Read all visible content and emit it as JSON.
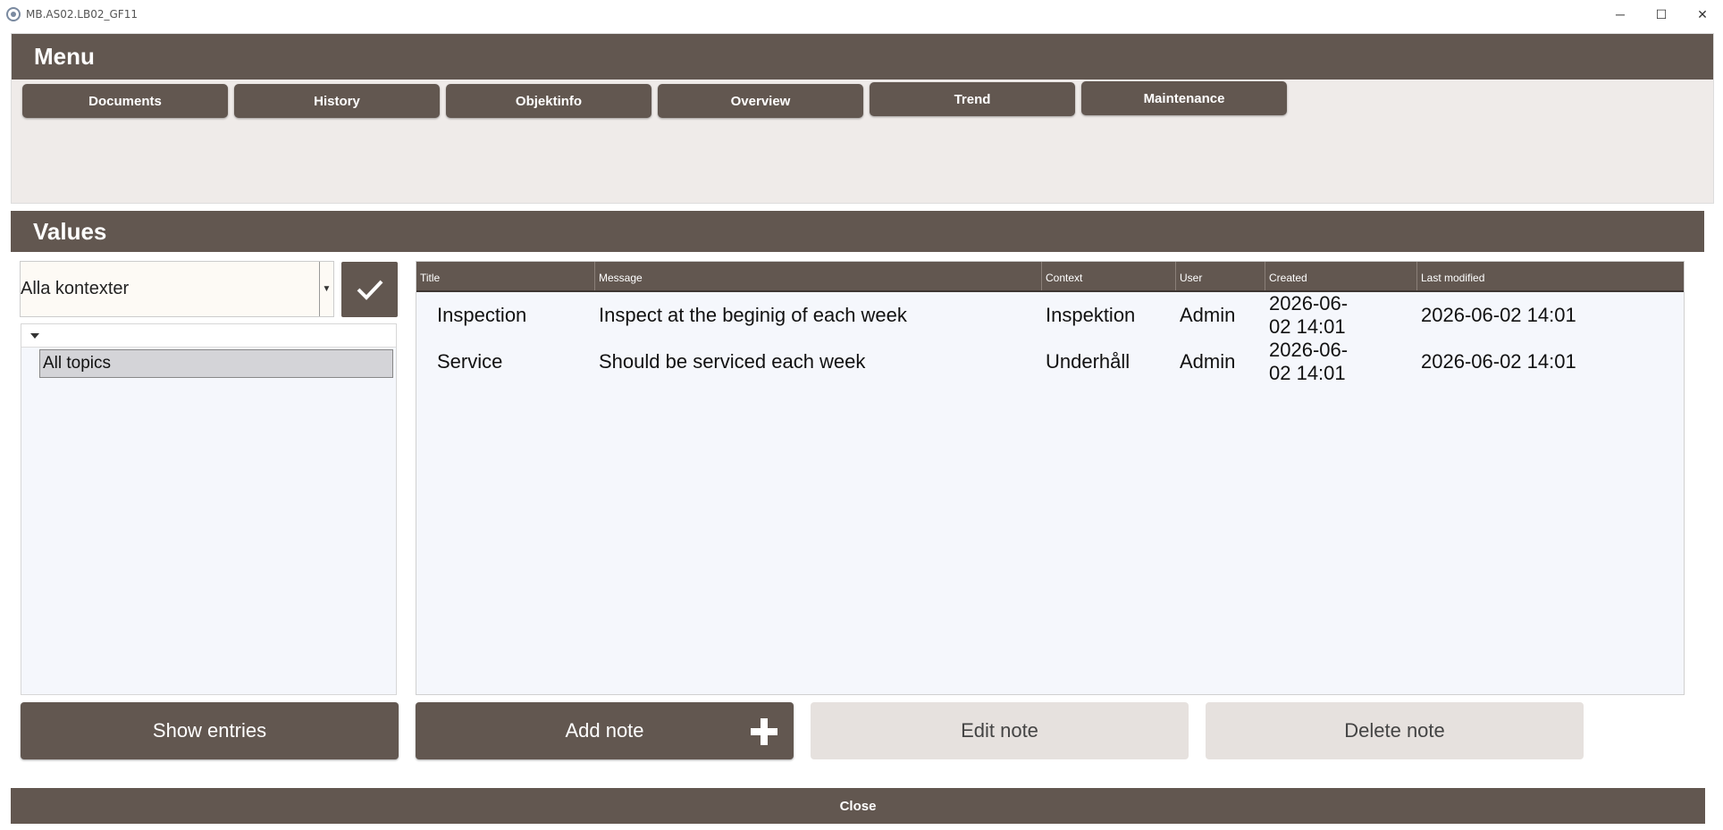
{
  "window": {
    "title": "MB.AS02.LB02_GF11",
    "minimize_glyph": "─",
    "maximize_glyph": "☐",
    "close_glyph": "✕"
  },
  "menu": {
    "header": "Menu",
    "tabs": [
      {
        "label": "Documents"
      },
      {
        "label": "History"
      },
      {
        "label": "Objektinfo"
      },
      {
        "label": "Overview"
      },
      {
        "label": "Trend"
      },
      {
        "label": "Maintenance"
      }
    ]
  },
  "values": {
    "header": "Values",
    "context_select": {
      "value": "Alla kontexter"
    },
    "tree": {
      "items": [
        {
          "label": "All topics",
          "selected": true
        }
      ]
    },
    "table": {
      "columns": [
        "Title",
        "Message",
        "Context",
        "User",
        "Created",
        "Last modified"
      ],
      "rows": [
        {
          "title": "Inspection",
          "message": "Inspect at the beginig of each week",
          "context": "Inspektion",
          "user": "Admin",
          "created": "2026-06-02 14:01",
          "last_modified": "2026-06-02 14:01"
        },
        {
          "title": "Service",
          "message": "Should be serviced each week",
          "context": "Underhåll",
          "user": "Admin",
          "created": "2026-06-02 14:01",
          "last_modified": "2026-06-02 14:01"
        }
      ]
    },
    "buttons": {
      "show_entries": "Show entries",
      "add_note": "Add note",
      "edit_note": "Edit note",
      "delete_note": "Delete note"
    }
  },
  "footer": {
    "close_label": "Close"
  },
  "colors": {
    "header_brown": "#625750",
    "panel_bg": "#efebe9",
    "grid_bg": "#f5f7fc",
    "disabled_button": "#e6e1de"
  }
}
